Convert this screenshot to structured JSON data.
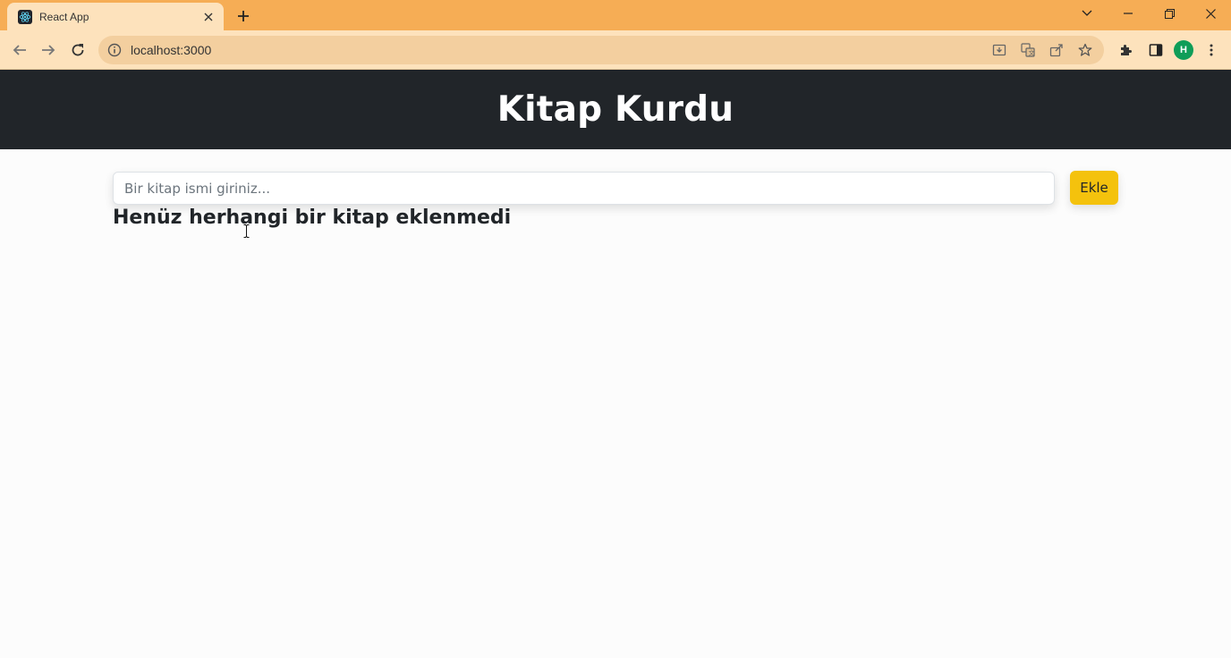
{
  "browser": {
    "tab_title": "React App",
    "tab_favicon": "react-logo-icon",
    "url": "localhost:3000",
    "avatar_letter": "H",
    "colors": {
      "titlebar": "#f6ad55",
      "toolbar": "#fde2bc",
      "avatar": "#0f9d58"
    }
  },
  "app": {
    "title": "Kitap Kurdu",
    "input_placeholder": "Bir kitap ismi giriniz...",
    "input_value": "",
    "add_button_label": "Ekle",
    "empty_message": "Henüz herhangi bir kitap eklenmedi",
    "colors": {
      "header_bg": "#212529",
      "button_bg": "#f4c20d"
    }
  }
}
